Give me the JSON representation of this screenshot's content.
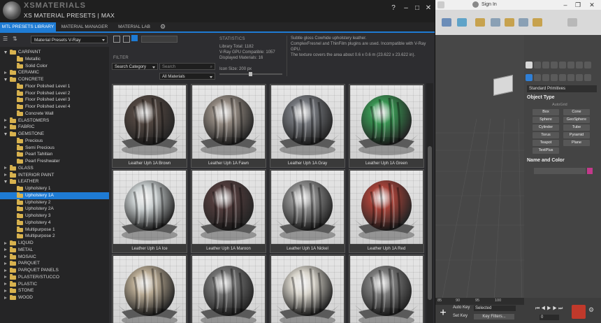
{
  "window": {
    "logo_text": "XSMATERIALS",
    "title": "XS MATERIAL PRESETS | MAX",
    "controls": {
      "help": "?",
      "minimize": "–",
      "maximize": "□",
      "close": "✕"
    }
  },
  "tabs": [
    {
      "label": "MTL PRESETS LIBRARY",
      "active": true
    },
    {
      "label": "MATERIAL MANAGER",
      "active": false
    },
    {
      "label": "MATERIAL LAB",
      "active": false
    }
  ],
  "library_select": "Material Presets V-Ray",
  "tree": [
    {
      "label": "CARPAINT",
      "level": 0,
      "open": true
    },
    {
      "label": "Metallic",
      "level": 1
    },
    {
      "label": "Solid Color",
      "level": 1
    },
    {
      "label": "CERAMIC",
      "level": 0,
      "open": false
    },
    {
      "label": "CONCRETE",
      "level": 0,
      "open": true
    },
    {
      "label": "Floor Polished Level 1",
      "level": 1
    },
    {
      "label": "Floor Polished Level 2",
      "level": 1
    },
    {
      "label": "Floor Polished Level 3",
      "level": 1
    },
    {
      "label": "Floor Polished Level 4",
      "level": 1
    },
    {
      "label": "Concrete Wall",
      "level": 1
    },
    {
      "label": "ELASTOMERS",
      "level": 0,
      "open": false
    },
    {
      "label": "FABRIC",
      "level": 0,
      "open": false
    },
    {
      "label": "GEMSTONE",
      "level": 0,
      "open": true
    },
    {
      "label": "Precious",
      "level": 1
    },
    {
      "label": "Semi Precious",
      "level": 1
    },
    {
      "label": "Pearl Tahitian",
      "level": 1
    },
    {
      "label": "Pearl Freshwater",
      "level": 1
    },
    {
      "label": "GLASS",
      "level": 0,
      "open": false
    },
    {
      "label": "INTERIOR PAINT",
      "level": 0,
      "open": false
    },
    {
      "label": "LEATHER",
      "level": 0,
      "open": true
    },
    {
      "label": "Upholstery 1",
      "level": 1
    },
    {
      "label": "Upholstery 1A",
      "level": 1,
      "selected": true
    },
    {
      "label": "Upholstery 2",
      "level": 1
    },
    {
      "label": "Upholstery 2A",
      "level": 1
    },
    {
      "label": "Upholstery 3",
      "level": 1
    },
    {
      "label": "Upholstery 4",
      "level": 1
    },
    {
      "label": "Multipurpose 1",
      "level": 1
    },
    {
      "label": "Multipurpose 2",
      "level": 1
    },
    {
      "label": "LIQUID",
      "level": 0,
      "open": false
    },
    {
      "label": "METAL",
      "level": 0,
      "open": false
    },
    {
      "label": "MOSAIC",
      "level": 0,
      "open": false
    },
    {
      "label": "PARQUET",
      "level": 0,
      "open": false
    },
    {
      "label": "PARQUET PANELS",
      "level": 0,
      "open": false
    },
    {
      "label": "PLASTER/STUCCO",
      "level": 0,
      "open": false
    },
    {
      "label": "PLASTIC",
      "level": 0,
      "open": false
    },
    {
      "label": "STONE",
      "level": 0,
      "open": false
    },
    {
      "label": "WOOD",
      "level": 0,
      "open": false
    }
  ],
  "filter": {
    "label": "FILTER",
    "category": "Search Category",
    "search_placeholder": "Search",
    "materials": "All Materials"
  },
  "statistics": {
    "label": "STATISTICS",
    "total": "Library Total: 1182",
    "gpu": "V-Ray GPU Compatible: 1057",
    "displayed": "Displayed Materials: 16",
    "icon_size": "Icon Size: 200 px"
  },
  "description": [
    "Subtle gloss Cowhide upholstery leather.",
    "ComplexFresnel and ThinFilm plugins are used. Incompatible with V-Ray",
    "GPU.",
    "The texture covers the area about 0.6 x 0.6 m (23.622 x 23.622 in)."
  ],
  "materials": [
    {
      "name": "Leather Uph 1A Brown",
      "color": "#4a3e38"
    },
    {
      "name": "Leather Uph 1A Fawn",
      "color": "#8f857c"
    },
    {
      "name": "Leather Uph 1A Gray",
      "color": "#6f7278"
    },
    {
      "name": "Leather Uph 1A Green",
      "color": "#2f8f4a"
    },
    {
      "name": "Leather Uph 1A Ice",
      "color": "#c9cfd0"
    },
    {
      "name": "Leather Uph 1A Maroon",
      "color": "#4a3434"
    },
    {
      "name": "Leather Uph 1A Nickel",
      "color": "#8a8a8a"
    },
    {
      "name": "Leather Uph 1A Red",
      "color": "#a33a30"
    },
    {
      "name": "",
      "color": "#b7a890"
    },
    {
      "name": "",
      "color": "#6e6e6e"
    },
    {
      "name": "",
      "color": "#d6d2c8"
    },
    {
      "name": "",
      "color": "#777777"
    }
  ],
  "max": {
    "signin": "Sign In",
    "cmd_dropdown": "Standard Primitives",
    "object_type": "Object Type",
    "autogrid": "AutoGrid",
    "primitives": [
      "Box",
      "Cone",
      "Sphere",
      "GeoSphere",
      "Cylinder",
      "Tube",
      "Torus",
      "Pyramid",
      "Teapot",
      "Plane",
      "TextPlus"
    ],
    "name_color": "Name and Color",
    "ticks": [
      "85",
      "90",
      "95",
      "100"
    ],
    "autokey": "Auto Key",
    "selected": "Selected",
    "setkey": "Set Key",
    "keyfilters": "Key Filters...",
    "frame": "0"
  }
}
